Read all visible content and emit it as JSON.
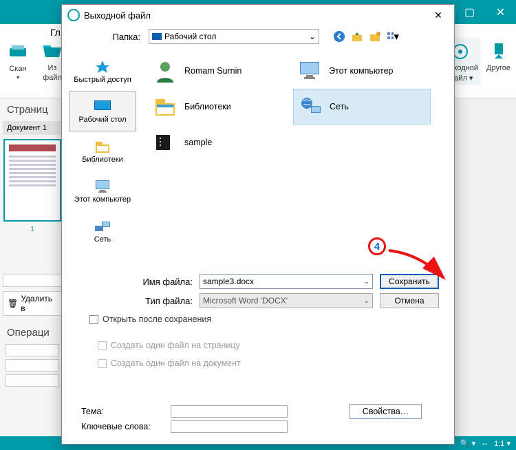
{
  "app": {
    "ribbon_tab": "Гл",
    "scan_label": "Скан",
    "from_file_label_1": "Из",
    "from_file_label_2": "файл",
    "output_label_1": "Выходной",
    "output_label_2": "файл",
    "other_label": "Другое"
  },
  "side": {
    "pages_title": "Страниц",
    "doc_tab": "Документ 1",
    "page_num": "1",
    "delete_label": "Удалить в",
    "ops_title": "Операци"
  },
  "status": {
    "zoom": "1:1"
  },
  "dialog": {
    "title": "Выходной файл",
    "folder_label": "Папка:",
    "folder_value": "Рабочий стол",
    "places": {
      "quick": "Быстрый доступ",
      "desktop": "Рабочий стол",
      "libraries": "Библиотеки",
      "thispc": "Этот компьютер",
      "network": "Сеть"
    },
    "items": {
      "user": "Romam Surnin",
      "libraries": "Библиотеки",
      "sample": "sample",
      "thispc": "Этот компьютер",
      "network": "Сеть"
    },
    "filename_label": "Имя файла:",
    "filename_value": "sample3.docx",
    "filetype_label": "Тип файла:",
    "filetype_value": "Microsoft Word 'DOCX'",
    "save_btn": "Сохранить",
    "cancel_btn": "Отмена",
    "open_after": "Открыть после сохранения",
    "one_per_page": "Создать один файл на страницу",
    "one_per_doc": "Создать один файл на документ",
    "subject_label": "Тема:",
    "keywords_label": "Ключевые слова:",
    "props_btn": "Свойства…"
  },
  "annotation": {
    "step": "4"
  }
}
